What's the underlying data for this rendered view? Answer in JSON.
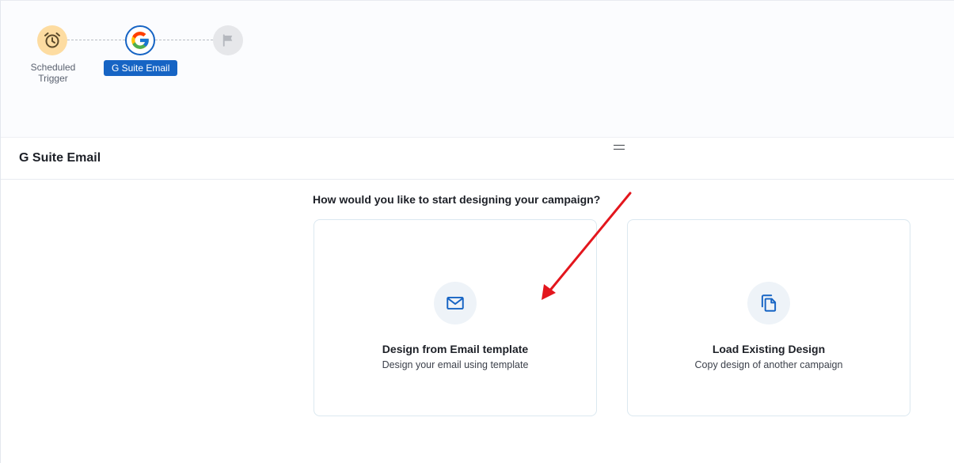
{
  "workflow": {
    "nodes": [
      {
        "label": "Scheduled Trigger",
        "icon": "alarm-clock-icon"
      },
      {
        "label": "G Suite Email",
        "icon": "google-g-icon"
      },
      {
        "label": "",
        "icon": "flag-icon"
      }
    ]
  },
  "panel": {
    "title": "G Suite Email",
    "question": "How would you like to start designing your campaign?"
  },
  "options": [
    {
      "title": "Design from Email template",
      "subtitle": "Design your email using template",
      "icon": "envelope-icon"
    },
    {
      "title": "Load Existing Design",
      "subtitle": "Copy design of another campaign",
      "icon": "copy-documents-icon"
    }
  ],
  "colors": {
    "accent": "#1664c4",
    "trigger_bg": "#fddca1",
    "annotation_arrow": "#e3161d"
  }
}
